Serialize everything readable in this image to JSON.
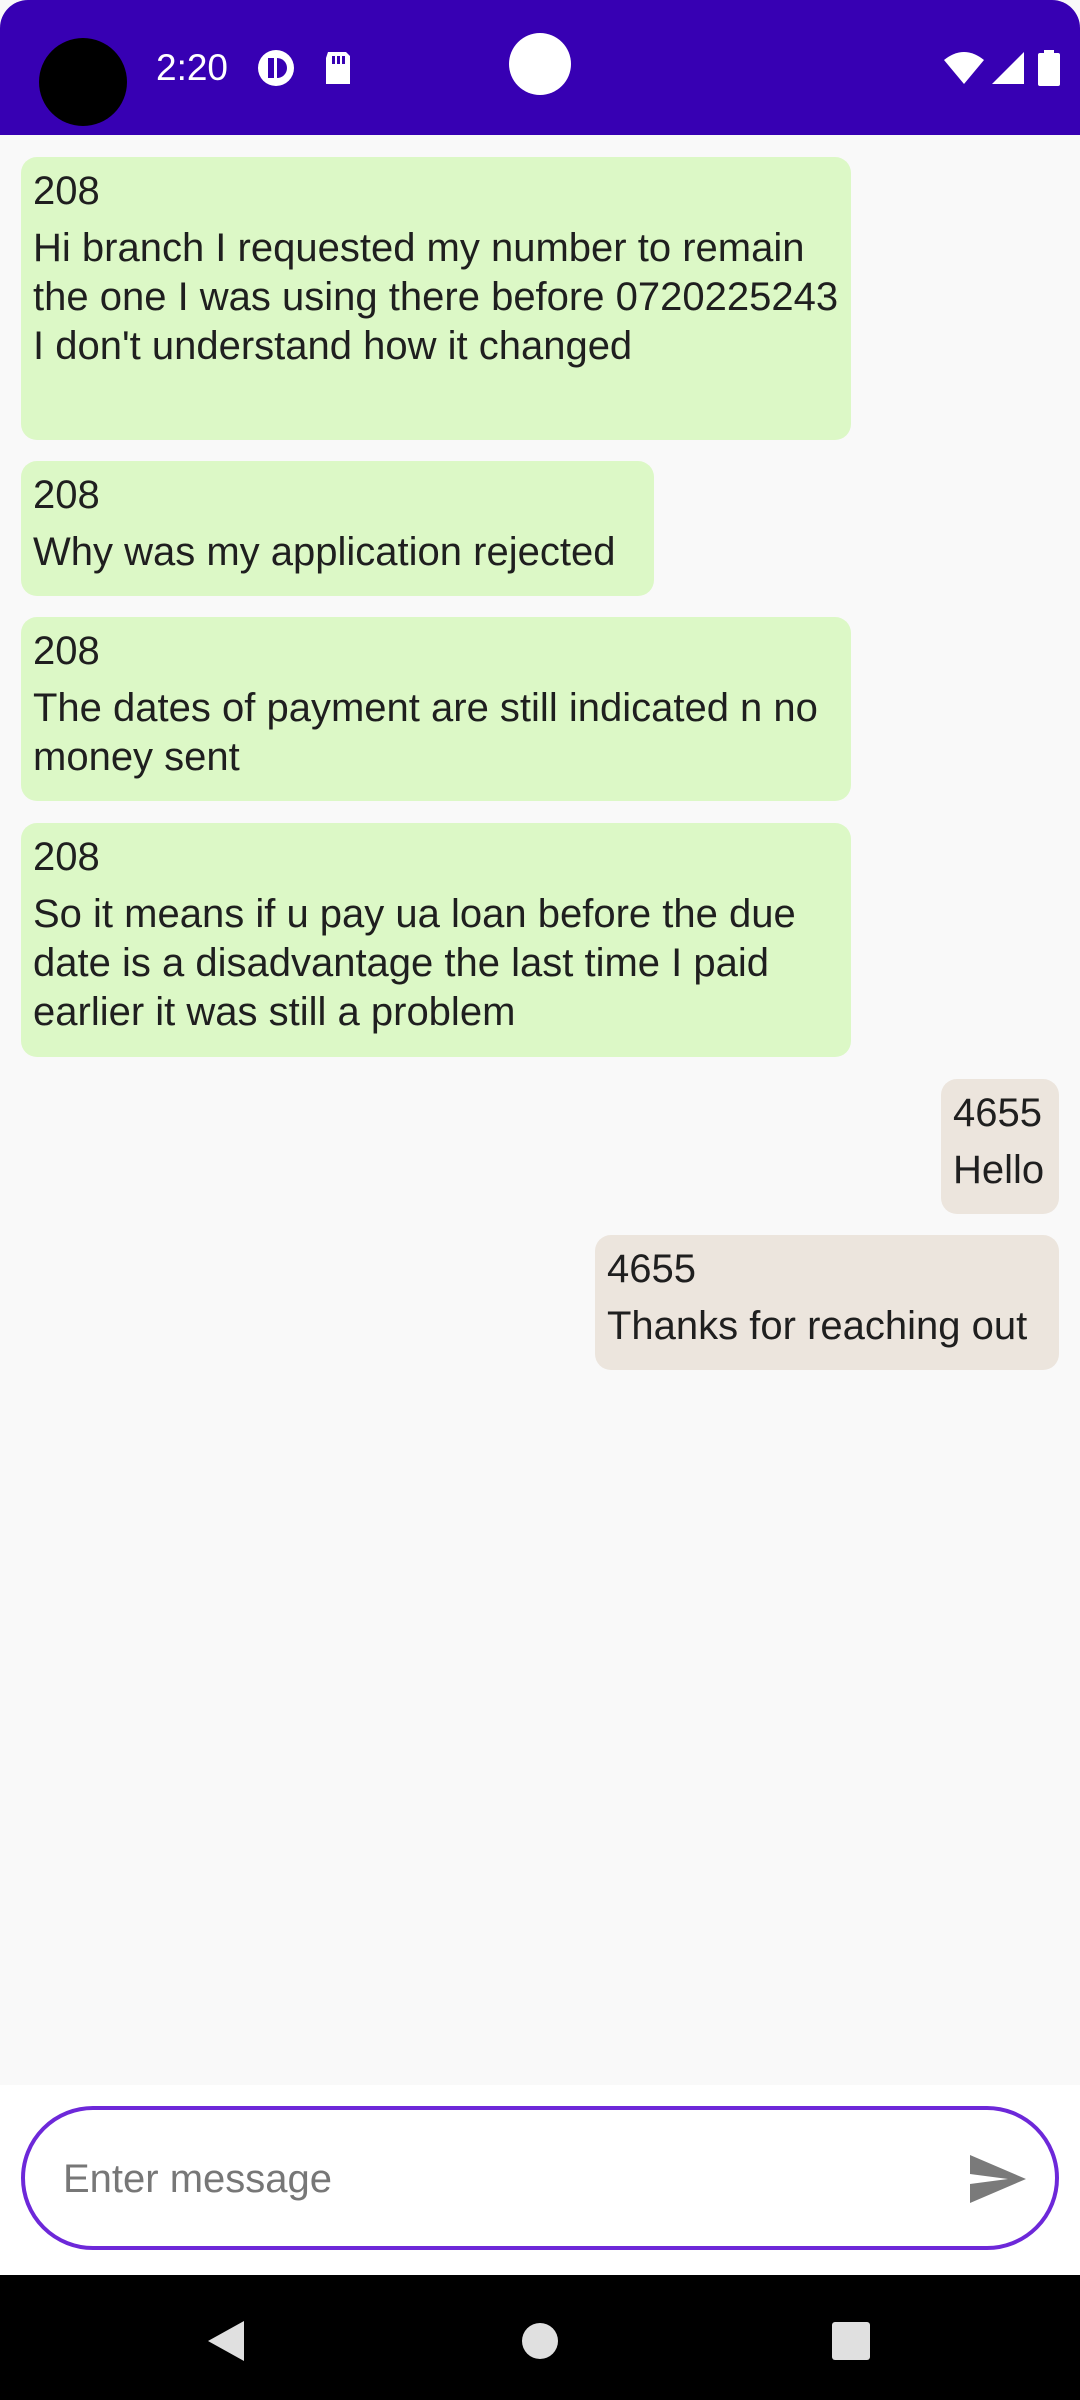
{
  "status_bar": {
    "time": "2:20",
    "background": "#3700b3",
    "icons": [
      "notification-app-icon",
      "sd-card-icon",
      "wifi-icon",
      "signal-icon",
      "battery-icon"
    ]
  },
  "messages": [
    {
      "direction": "incoming",
      "sender": "208",
      "text": "Hi branch I requested my number to remain the one I was using there before 0720225243  I don't understand how it changed"
    },
    {
      "direction": "incoming",
      "sender": "208",
      "text": "Why was my application rejected"
    },
    {
      "direction": "incoming",
      "sender": "208",
      "text": "The dates of payment are still indicated n no money sent"
    },
    {
      "direction": "incoming",
      "sender": "208",
      "text": "So it means if u pay ua loan before the due date is a disadvantage the last time I paid earlier it was still a problem"
    },
    {
      "direction": "outgoing",
      "sender": "4655",
      "text": "Hello"
    },
    {
      "direction": "outgoing",
      "sender": "4655",
      "text": "Thanks for reaching out"
    }
  ],
  "colors": {
    "incoming_bubble": "#dcf8c6",
    "outgoing_bubble": "#ece5dd",
    "composer_border": "#6d28d9",
    "background": "#f9f9f9"
  },
  "composer": {
    "placeholder": "Enter message",
    "value": ""
  },
  "nav": {
    "icons": [
      "back-icon",
      "home-icon",
      "recents-icon"
    ]
  }
}
